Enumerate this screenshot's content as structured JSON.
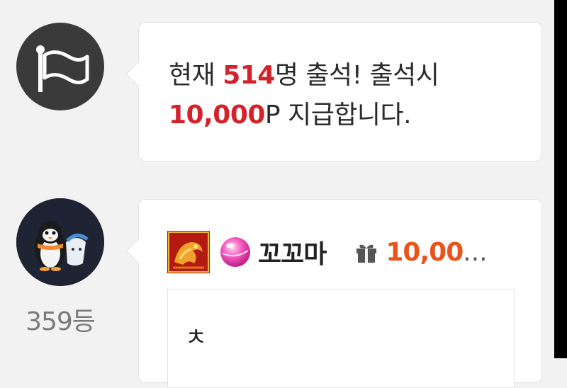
{
  "notice": {
    "line1_prefix": "현재 ",
    "count": "514",
    "line1_suffix": "명 출석! 출석시",
    "amount": "10,000",
    "line2_suffix": "P 지급합니다."
  },
  "post": {
    "rank": "359등",
    "nickname": "꼬꼬마",
    "points": "10,00",
    "points_ellipsis": "...",
    "content": "ㅊ"
  },
  "colors": {
    "accent_red": "#d4222a",
    "points_orange": "#e8541c",
    "avatar_bg": "#3a3a3a"
  },
  "icons": {
    "notice_avatar": "flag-icon",
    "user_avatar": "penguin-avatar",
    "level": "dragon-level-icon",
    "grade": "pink-orb-icon",
    "gift": "gift-icon"
  }
}
